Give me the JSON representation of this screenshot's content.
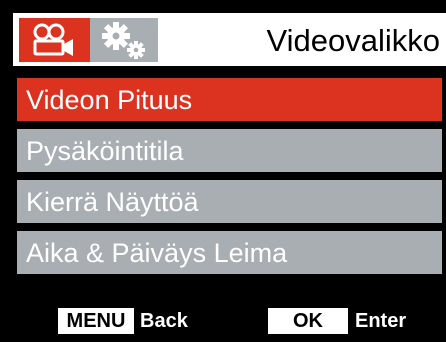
{
  "header": {
    "title": "Videovalikko",
    "tabs": [
      {
        "icon": "video-camera-icon",
        "active": true
      },
      {
        "icon": "settings-gears-icon",
        "active": false
      }
    ]
  },
  "menu": {
    "items": [
      {
        "label": "Videon Pituus",
        "selected": true
      },
      {
        "label": "Pysäköintitila",
        "selected": false
      },
      {
        "label": "Kierrä Näyttöä",
        "selected": false
      },
      {
        "label": "Aika & Päiväys Leima",
        "selected": false
      }
    ]
  },
  "footer": {
    "menu_key": "MENU",
    "menu_action": "Back",
    "ok_key": "OK",
    "ok_action": "Enter"
  },
  "colors": {
    "accent": "#dc3321",
    "item_bg": "#a8aeb2",
    "background": "#000000",
    "header_bg": "#ffffff"
  }
}
